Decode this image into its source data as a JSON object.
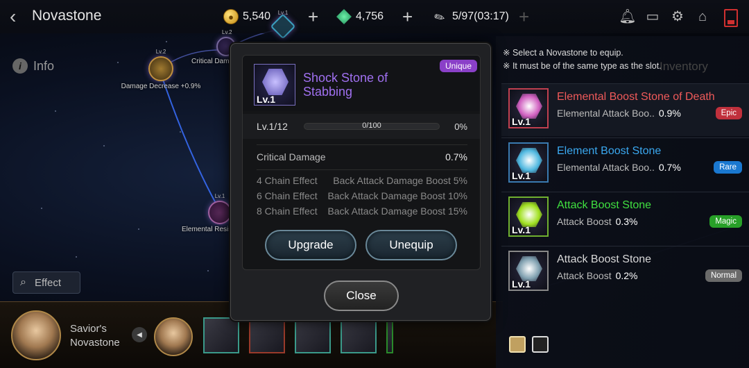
{
  "topbar": {
    "title": "Novastone",
    "gold": "5,540",
    "gems": "4,756",
    "stamina": "5/97(03:17)",
    "back_icon": "back-arrow-icon",
    "icons": [
      "bell-icon",
      "chat-icon",
      "gear-icon",
      "home-icon",
      "battery-icon"
    ]
  },
  "info_label": "Info",
  "map_nodes": [
    {
      "level": "Lv.2",
      "label": "Damage Decrease +0.9%"
    },
    {
      "level": "Lv.2",
      "label": "Critical Dam"
    },
    {
      "level": "Lv.1",
      "label": ""
    },
    {
      "level": "Lv.1",
      "label": "Elemental Resis"
    }
  ],
  "effect_label": "Effect",
  "bottom": {
    "savior_line1": "Savior's",
    "savior_line2": "Novastone"
  },
  "right_panel": {
    "note1": "※ Select a Novastone to equip.",
    "note2": "※ It must be of the same type as the slot.",
    "inventory_label": "Inventory",
    "items": [
      {
        "level": "Lv.1",
        "name": "Elemental Boost Stone of Death",
        "stat": "Elemental Attack Boo..",
        "value": "0.9%",
        "rarity": "Epic",
        "name_color": "#f05a5a",
        "badge_color": "#c0303c",
        "hex_color": "#d060c0"
      },
      {
        "level": "Lv.1",
        "name": "Element Boost Stone",
        "stat": "Elemental Attack Boo..",
        "value": "0.7%",
        "rarity": "Rare",
        "name_color": "#3aa8f0",
        "badge_color": "#1a78d0",
        "hex_color": "#50b8e0"
      },
      {
        "level": "Lv.1",
        "name": "Attack Boost Stone",
        "stat": "Attack Boost",
        "value": "0.3%",
        "rarity": "Magic",
        "name_color": "#40e040",
        "badge_color": "#28a028",
        "hex_color": "#a0e020"
      },
      {
        "level": "Lv.1",
        "name": "Attack Boost Stone",
        "stat": "Attack Boost",
        "value": "0.2%",
        "rarity": "Normal",
        "name_color": "#d8d8d8",
        "badge_color": "#6a6a6a",
        "hex_color": "#80a0b0"
      }
    ]
  },
  "detail": {
    "level_badge": "Lv.1",
    "name": "Shock Stone of Stabbing",
    "rarity": "Unique",
    "level_text": "Lv.1/12",
    "xp_text": "0/100",
    "xp_progress": 0,
    "xp_pct": "0%",
    "stat_name": "Critical Damage",
    "stat_value": "0.7%",
    "chains": [
      {
        "label": "4 Chain Effect",
        "value": "Back Attack Damage Boost 5%"
      },
      {
        "label": "6 Chain Effect",
        "value": "Back Attack Damage Boost 10%"
      },
      {
        "label": "8 Chain Effect",
        "value": "Back Attack Damage Boost 15%"
      }
    ],
    "upgrade_label": "Upgrade",
    "unequip_label": "Unequip",
    "close_label": "Close"
  }
}
